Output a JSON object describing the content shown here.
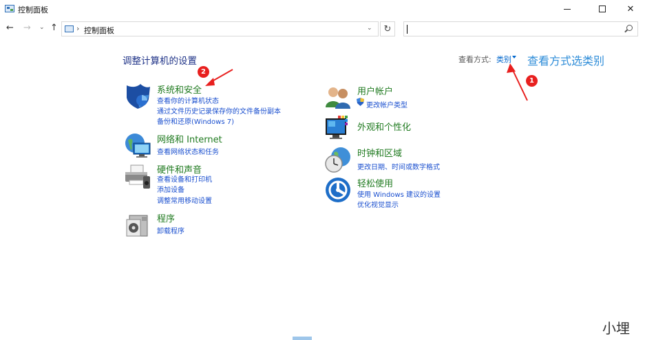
{
  "window": {
    "title": "控制面板",
    "minimize_label": "—",
    "close_label": "✕"
  },
  "address_bar": {
    "breadcrumb": "控制面板",
    "separator": "›",
    "search_placeholder": ""
  },
  "nav": {
    "back": "←",
    "forward": "→",
    "recent": "⌄",
    "up": "↑",
    "dropdown": "⌄",
    "refresh": "↻"
  },
  "main": {
    "title": "调整计算机的设置",
    "view_by_label": "查看方式:",
    "view_by_value": "类别"
  },
  "categories_left": [
    {
      "title": "系统和安全",
      "icon": "shield-icon",
      "links": [
        "查看你的计算机状态",
        "通过文件历史记录保存你的文件备份副本",
        "备份和还原(Windows 7)"
      ]
    },
    {
      "title": "网络和 Internet",
      "icon": "network-icon",
      "links": [
        "查看网络状态和任务"
      ]
    },
    {
      "title": "硬件和声音",
      "icon": "printer-icon",
      "links": [
        "查看设备和打印机",
        "添加设备",
        "调整常用移动设置"
      ]
    },
    {
      "title": "程序",
      "icon": "programs-icon",
      "links": [
        "卸载程序"
      ]
    }
  ],
  "categories_right": [
    {
      "title": "用户帐户",
      "icon": "users-icon",
      "links": [
        "更改帐户类型"
      ]
    },
    {
      "title": "外观和个性化",
      "icon": "monitor-icon",
      "links": []
    },
    {
      "title": "时钟和区域",
      "icon": "clock-globe-icon",
      "links": [
        "更改日期、时间或数字格式"
      ]
    },
    {
      "title": "轻松使用",
      "icon": "ease-of-access-icon",
      "links": [
        "使用 Windows 建议的设置",
        "优化视觉显示"
      ]
    }
  ],
  "annotations": {
    "badge_1": "1",
    "badge_2": "2",
    "text": "查看方式选类别",
    "color": "#e8201f"
  },
  "watermark": "小埋"
}
